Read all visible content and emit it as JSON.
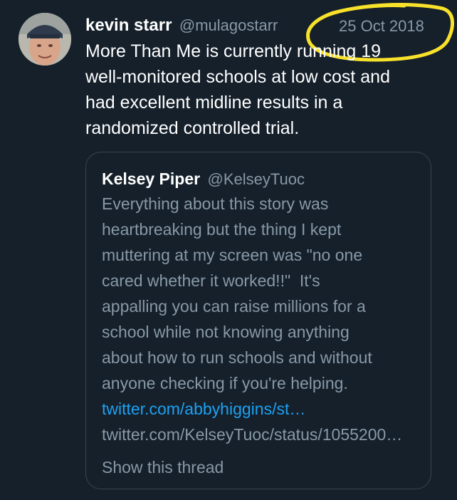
{
  "tweet": {
    "author": {
      "display_name": "kevin starr",
      "handle": "@mulagostarr",
      "avatar_icon": "profile-photo"
    },
    "date": "25 Oct 2018",
    "text": "More Than Me is currently running 19\nwell-monitored schools at low cost and\nhad excellent midline results in a\nrandomized controlled trial.",
    "highlight_color": "#f7e12a"
  },
  "quoted_tweet": {
    "author": {
      "display_name": "Kelsey Piper",
      "handle": "@KelseyTuoc"
    },
    "text": "Everything about this story was\nheartbreaking but the thing I kept\nmuttering at my screen was \"no one\ncared whether it worked!!\"  It's\nappalling you can raise millions for a\nschool while not knowing anything\nabout how to run schools and without\nanyone checking if you're helping.",
    "link_text": "twitter.com/abbyhiggins/st…",
    "url_text": "twitter.com/KelseyTuoc/status/1055200…",
    "show_thread_label": "Show this thread"
  },
  "colors": {
    "background": "#15202b",
    "primary_text": "#ffffff",
    "secondary_text": "#8899a6",
    "link": "#1da1f2",
    "border": "#38444d"
  }
}
